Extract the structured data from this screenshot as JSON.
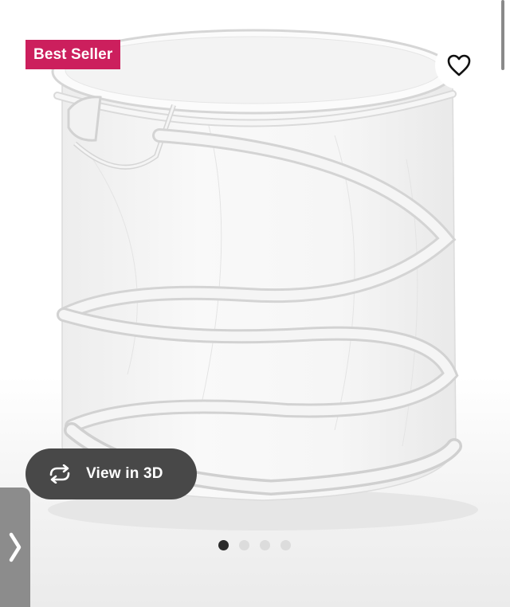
{
  "product": {
    "badge": "Best Seller",
    "image_alt": "white mesh pop-up laundry hamper"
  },
  "actions": {
    "favorite_icon": "heart-outline-icon",
    "view3d_label": "View in 3D",
    "view3d_icon": "rotate-arrows-icon",
    "next_icon": "chevron-right-icon"
  },
  "carousel": {
    "total": 4,
    "active_index": 0
  },
  "colors": {
    "badge": "#cc1f5d",
    "view3d_bg": "#484848",
    "side_arrow": "#8c8c8c",
    "dot_active": "#2b2b2b",
    "dot_inactive": "#dcdcdc"
  }
}
